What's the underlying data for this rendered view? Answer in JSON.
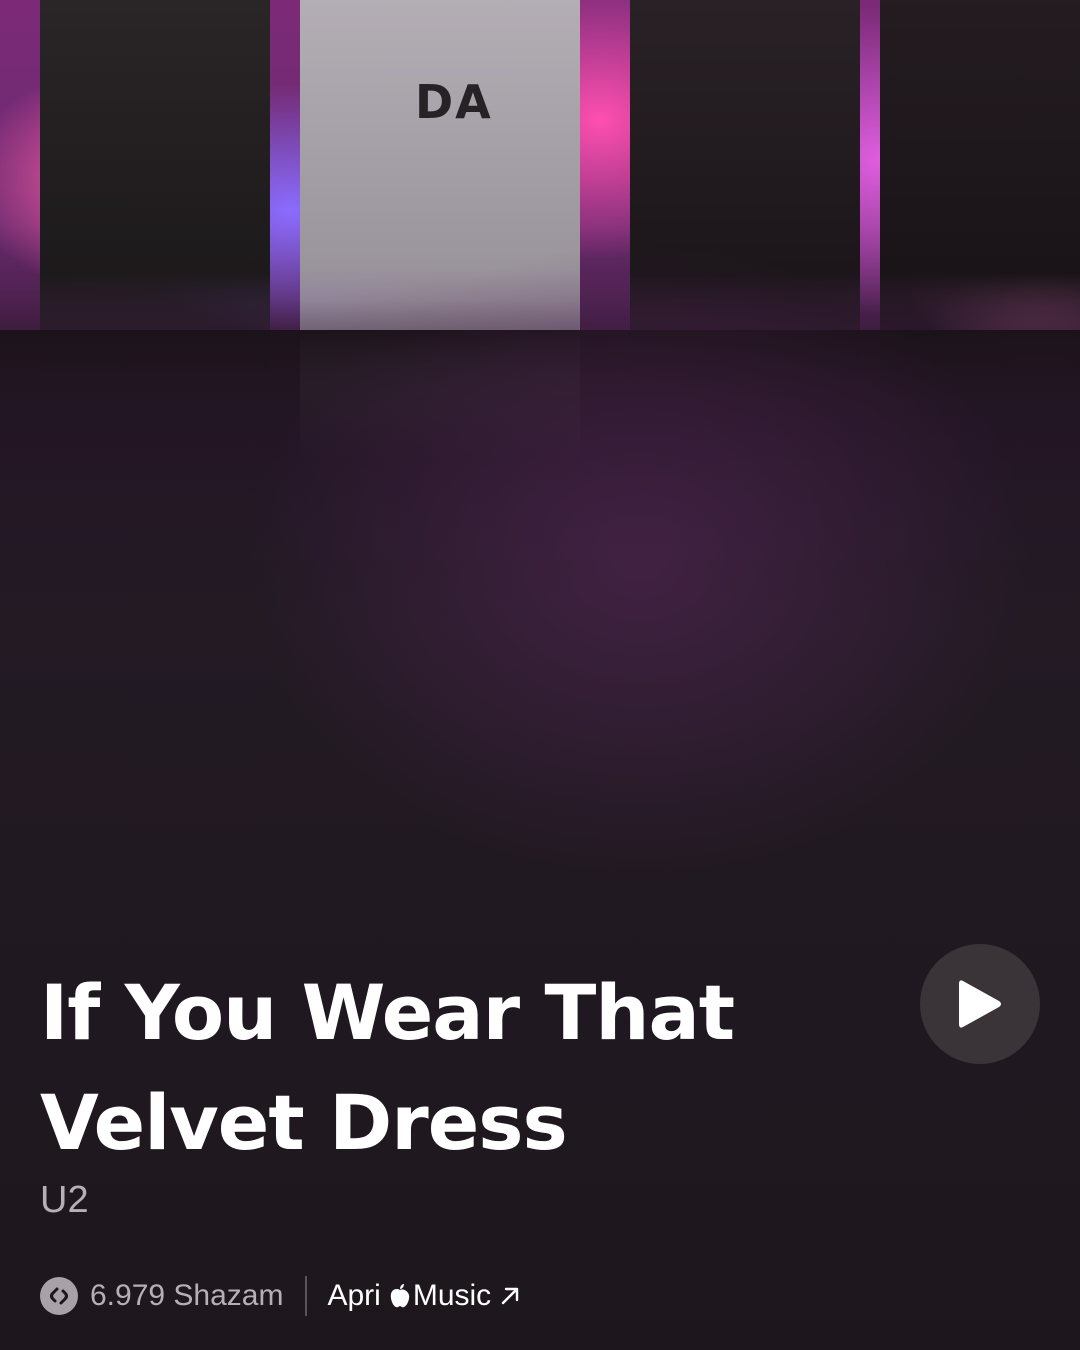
{
  "hero": {
    "shirt_text": "DA"
  },
  "song": {
    "title": "If You Wear That Velvet Dress",
    "artist": "U2"
  },
  "play_button": {
    "icon": "play-icon"
  },
  "footer": {
    "shazam_icon": "shazam-icon",
    "count_label": "6.979 Shazam",
    "music_prefix": "Apri",
    "music_label": "Music",
    "apple_icon": "apple-logo-icon",
    "arrow_icon": "arrow-up-right-icon"
  },
  "colors": {
    "background": "#1e161e",
    "accent": "#7c2a78",
    "play_button_bg": "#3a3338"
  }
}
